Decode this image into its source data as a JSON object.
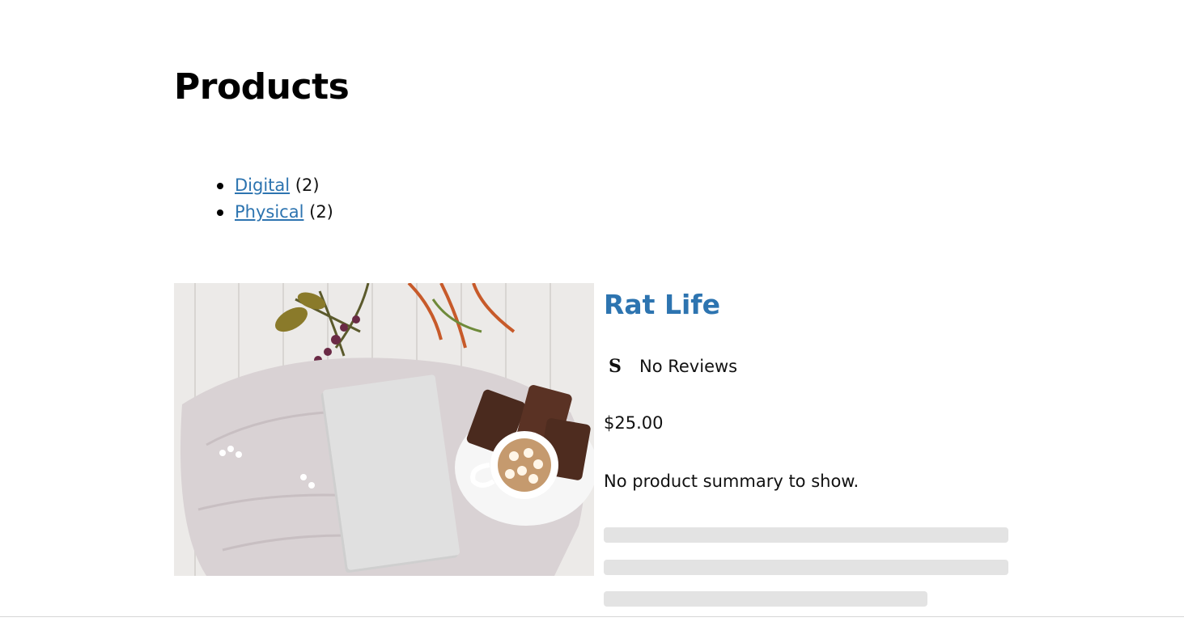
{
  "page": {
    "title": "Products"
  },
  "categories": [
    {
      "label": "Digital",
      "count": "(2)"
    },
    {
      "label": "Physical",
      "count": "(2)"
    }
  ],
  "product": {
    "name": "Rat Life",
    "reviews_icon": "star-icon",
    "reviews_label": "No Reviews",
    "price": "$25.00",
    "summary": "No product summary to show."
  },
  "colors": {
    "link": "#2d74b0",
    "skeleton": "#e3e3e3"
  }
}
